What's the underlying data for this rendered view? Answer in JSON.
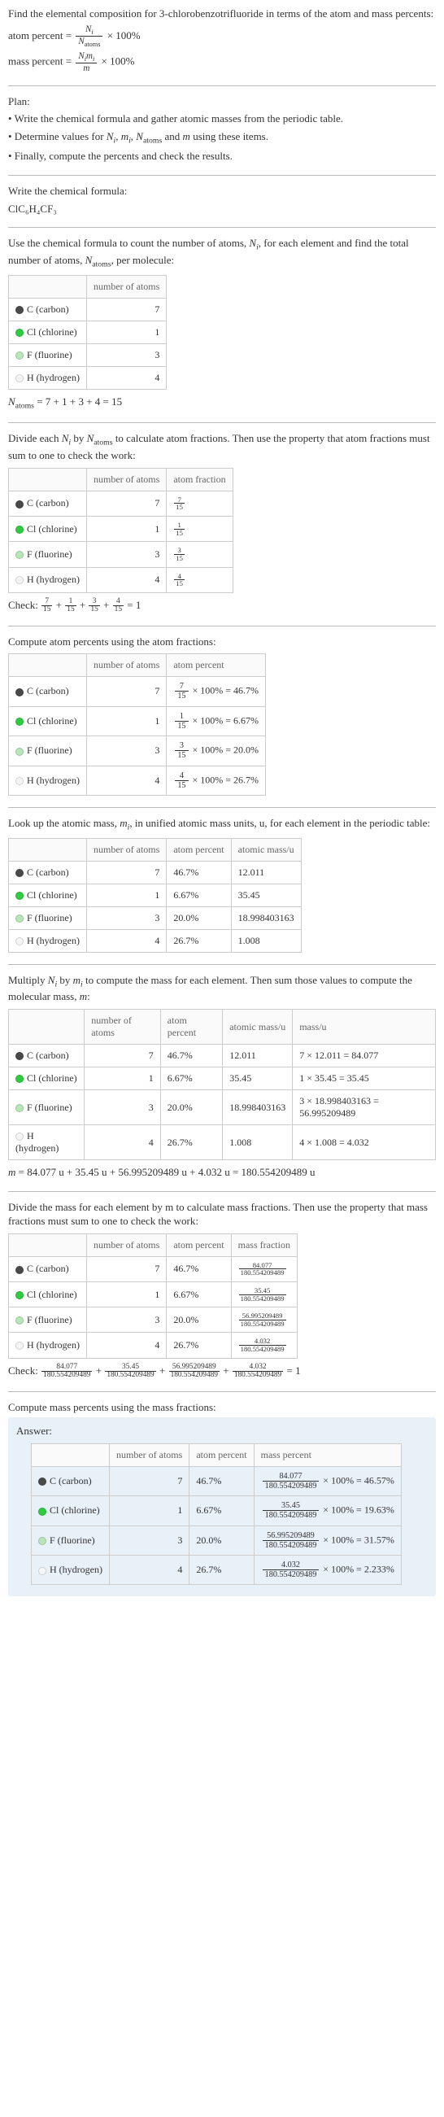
{
  "intro": {
    "line1": "Find the elemental composition for 3-chlorobenzotrifluoride in terms of the atom and mass percents:",
    "atom_percent_lhs": "atom percent =",
    "atom_percent_num": "N_i",
    "atom_percent_den": "N_atoms",
    "times100": "× 100%",
    "mass_percent_lhs": "mass percent =",
    "mass_percent_num": "N_i m_i",
    "mass_percent_den": "m"
  },
  "plan": {
    "heading": "Plan:",
    "b1": "• Write the chemical formula and gather atomic masses from the periodic table.",
    "b2_a": "• Determine values for ",
    "b2_b": " using these items.",
    "b3": "• Finally, compute the percents and check the results."
  },
  "formula_section": {
    "heading": "Write the chemical formula:",
    "formula": "ClC₆H₄CF₃"
  },
  "count_section": {
    "text_a": "Use the chemical formula to count the number of atoms, ",
    "text_b": ", for each element and find the total number of atoms, ",
    "text_c": ", per molecule:",
    "header_num": "number of atoms",
    "rows": [
      {
        "el": "C (carbon)",
        "n": "7"
      },
      {
        "el": "Cl (chlorine)",
        "n": "1"
      },
      {
        "el": "F (fluorine)",
        "n": "3"
      },
      {
        "el": "H (hydrogen)",
        "n": "4"
      }
    ],
    "total_lhs": "N_atoms",
    "total_eq": " = 7 + 1 + 3 + 4 = 15"
  },
  "atomfrac_section": {
    "text": "Divide each N_i by N_atoms to calculate atom fractions. Then use the property that atom fractions must sum to one to check the work:",
    "header_frac": "atom fraction",
    "rows": [
      {
        "el": "C (carbon)",
        "n": "7",
        "fn": "7",
        "fd": "15"
      },
      {
        "el": "Cl (chlorine)",
        "n": "1",
        "fn": "1",
        "fd": "15"
      },
      {
        "el": "F (fluorine)",
        "n": "3",
        "fn": "3",
        "fd": "15"
      },
      {
        "el": "H (hydrogen)",
        "n": "4",
        "fn": "4",
        "fd": "15"
      }
    ],
    "check_label": "Check: ",
    "check_rhs": " = 1"
  },
  "atompct_section": {
    "text": "Compute atom percents using the atom fractions:",
    "header_pct": "atom percent",
    "rows": [
      {
        "el": "C (carbon)",
        "n": "7",
        "fn": "7",
        "fd": "15",
        "pct": "46.7%"
      },
      {
        "el": "Cl (chlorine)",
        "n": "1",
        "fn": "1",
        "fd": "15",
        "pct": "6.67%"
      },
      {
        "el": "F (fluorine)",
        "n": "3",
        "fn": "3",
        "fd": "15",
        "pct": "20.0%"
      },
      {
        "el": "H (hydrogen)",
        "n": "4",
        "fn": "4",
        "fd": "15",
        "pct": "26.7%"
      }
    ],
    "times_eq": " × 100% = "
  },
  "mass_lookup": {
    "text": "Look up the atomic mass, m_i, in unified atomic mass units, u, for each element in the periodic table:",
    "header_mass": "atomic mass/u",
    "rows": [
      {
        "el": "C (carbon)",
        "n": "7",
        "pct": "46.7%",
        "m": "12.011"
      },
      {
        "el": "Cl (chlorine)",
        "n": "1",
        "pct": "6.67%",
        "m": "35.45"
      },
      {
        "el": "F (fluorine)",
        "n": "3",
        "pct": "20.0%",
        "m": "18.998403163"
      },
      {
        "el": "H (hydrogen)",
        "n": "4",
        "pct": "26.7%",
        "m": "1.008"
      }
    ]
  },
  "mult_section": {
    "text": "Multiply N_i by m_i to compute the mass for each element. Then sum those values to compute the molecular mass, m:",
    "header_massu": "mass/u",
    "rows": [
      {
        "el": "C (carbon)",
        "n": "7",
        "pct": "46.7%",
        "m": "12.011",
        "calc": "7 × 12.011 = 84.077"
      },
      {
        "el": "Cl (chlorine)",
        "n": "1",
        "pct": "6.67%",
        "m": "35.45",
        "calc": "1 × 35.45 = 35.45"
      },
      {
        "el": "F (fluorine)",
        "n": "3",
        "pct": "20.0%",
        "m": "18.998403163",
        "calc": "3 × 18.998403163 = 56.995209489"
      },
      {
        "el": "H (hydrogen)",
        "n": "4",
        "pct": "26.7%",
        "m": "1.008",
        "calc": "4 × 1.008 = 4.032"
      }
    ],
    "total": "m = 84.077 u + 35.45 u + 56.995209489 u + 4.032 u = 180.554209489 u"
  },
  "massfrac_section": {
    "text": "Divide the mass for each element by m to calculate mass fractions. Then use the property that mass fractions must sum to one to check the work:",
    "header_mf": "mass fraction",
    "rows": [
      {
        "el": "C (carbon)",
        "n": "7",
        "pct": "46.7%",
        "fn": "84.077",
        "fd": "180.554209489"
      },
      {
        "el": "Cl (chlorine)",
        "n": "1",
        "pct": "6.67%",
        "fn": "35.45",
        "fd": "180.554209489"
      },
      {
        "el": "F (fluorine)",
        "n": "3",
        "pct": "20.0%",
        "fn": "56.995209489",
        "fd": "180.554209489"
      },
      {
        "el": "H (hydrogen)",
        "n": "4",
        "pct": "26.7%",
        "fn": "4.032",
        "fd": "180.554209489"
      }
    ],
    "check_label": "Check: ",
    "check_rhs": " = 1"
  },
  "masspct_section": {
    "text": "Compute mass percents using the mass fractions:",
    "answer_label": "Answer:",
    "header_mp": "mass percent",
    "rows": [
      {
        "el": "C (carbon)",
        "n": "7",
        "pct": "46.7%",
        "fn": "84.077",
        "fd": "180.554209489",
        "res": "46.57%"
      },
      {
        "el": "Cl (chlorine)",
        "n": "1",
        "pct": "6.67%",
        "fn": "35.45",
        "fd": "180.554209489",
        "res": "19.63%"
      },
      {
        "el": "F (fluorine)",
        "n": "3",
        "pct": "20.0%",
        "fn": "56.995209489",
        "fd": "180.554209489",
        "res": "31.57%"
      },
      {
        "el": "H (hydrogen)",
        "n": "4",
        "pct": "26.7%",
        "fn": "4.032",
        "fd": "180.554209489",
        "res": "2.233%"
      }
    ],
    "times_eq": " × 100% = "
  },
  "labels": {
    "number_of_atoms": "number of atoms",
    "atom_percent": "atom percent",
    "atom_fraction": "atom fraction",
    "atomic_mass": "atomic mass/u",
    "mass_u": "mass/u",
    "mass_fraction": "mass fraction",
    "mass_percent": "mass percent"
  },
  "swatch": {
    "C": "sw-c",
    "Cl": "sw-cl",
    "F": "sw-f",
    "H": "sw-h"
  }
}
